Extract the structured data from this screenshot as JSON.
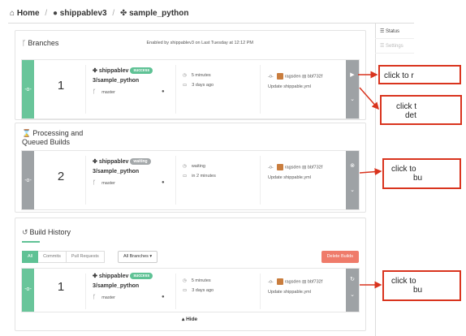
{
  "breadcrumb": {
    "home": "Home",
    "owner": "shippablev3",
    "repo": "sample_python",
    "sep": "/"
  },
  "rightnav": {
    "status": "Status",
    "settings": "Settings"
  },
  "branches": {
    "title": "Branches",
    "note": "Enabled by shippablev3 on Last Tuesday at 12:12 PM",
    "card": {
      "number": "1",
      "repo_line1": "shippablev",
      "badge": "success",
      "repo_line2": "3/sample_python",
      "branch": "master",
      "time1": "5 minutes",
      "time2": "3 days ago",
      "author": "ragsden",
      "sha": "bbf732f",
      "message": "Update shippable.yml"
    }
  },
  "processing": {
    "title_line1": "Processing and",
    "title_line2": "Queued Builds",
    "card": {
      "number": "2",
      "repo_line1": "shippablev",
      "badge": "waiting",
      "repo_line2": "3/sample_python",
      "branch": "master",
      "time1": "waiting",
      "time2": "in 2 minutes",
      "author": "ragsden",
      "sha": "bbf732f",
      "message": "Update shippable.yml"
    }
  },
  "history": {
    "title": "Build History",
    "tabs": [
      "All",
      "Commits",
      "Pull Requests"
    ],
    "branch_filter": "All Branches ▾",
    "delete_label": "Delete Builds",
    "hide_label": "Hide",
    "card": {
      "number": "1",
      "repo_line1": "shippablev",
      "badge": "success",
      "repo_line2": "3/sample_python",
      "branch": "master",
      "time1": "5 minutes",
      "time2": "3 days ago",
      "author": "ragsden",
      "sha": "bbf732f",
      "message": "Update shippable.yml"
    }
  },
  "callouts": {
    "c1": "click to r",
    "c2_line1": "click t",
    "c2_line2": "det",
    "c3_line1": "click to",
    "c3_line2": "bu",
    "c4_line1": "click to",
    "c4_line2": "bu"
  },
  "colors": {
    "green": "#69c59a",
    "grey": "#9ea2a5",
    "danger": "#ef7b6a",
    "callout": "#d9341e"
  },
  "icons": [
    "home-icon",
    "github-icon",
    "puzzle-icon",
    "branch-icon",
    "hourglass-icon",
    "history-icon",
    "clock-icon",
    "calendar-icon",
    "commit-icon",
    "file-icon",
    "play-icon",
    "chevron-down-icon",
    "stop-icon",
    "refresh-icon",
    "list-icon"
  ]
}
